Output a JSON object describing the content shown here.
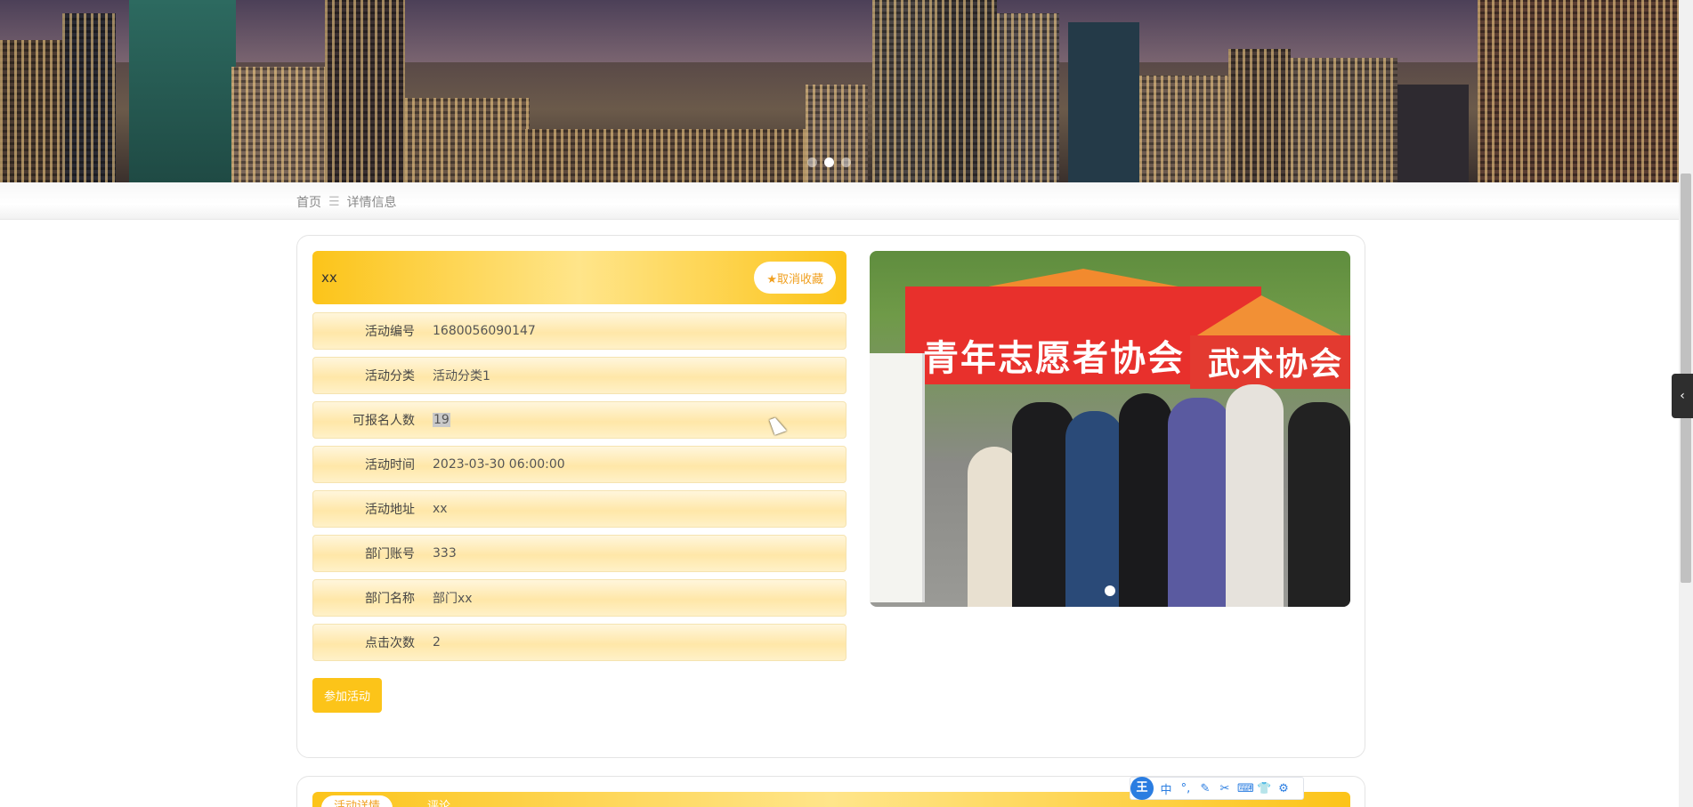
{
  "breadcrumb": {
    "home": "首页",
    "separator": "☰",
    "current": "详情信息"
  },
  "detail": {
    "title": "xx",
    "favorite_label": "★取消收藏",
    "fields": [
      {
        "label": "活动编号",
        "value": "1680056090147"
      },
      {
        "label": "活动分类",
        "value": "活动分类1"
      },
      {
        "label": "可报名人数",
        "value": "19"
      },
      {
        "label": "活动时间",
        "value": "2023-03-30 06:00:00"
      },
      {
        "label": "活动地址",
        "value": "xx"
      },
      {
        "label": "部门账号",
        "value": "333"
      },
      {
        "label": "部门名称",
        "value": "部门xx"
      },
      {
        "label": "点击次数",
        "value": "2"
      }
    ],
    "join_label": "参加活动"
  },
  "photo": {
    "text_left": "青年志愿者协会",
    "text_right": "武术协会"
  },
  "tabs": [
    {
      "label": "活动详情"
    },
    {
      "label": "评论"
    }
  ],
  "ime": {
    "logo": "王",
    "items": [
      "中",
      "°,",
      "✎",
      "✂",
      "⌨",
      "👕",
      "⚙"
    ]
  },
  "colors": {
    "accent": "#fcc419",
    "accent_light": "#ffe58a",
    "favorite_text": "#f0a020"
  },
  "side_toggle": {
    "icon": "‹"
  }
}
